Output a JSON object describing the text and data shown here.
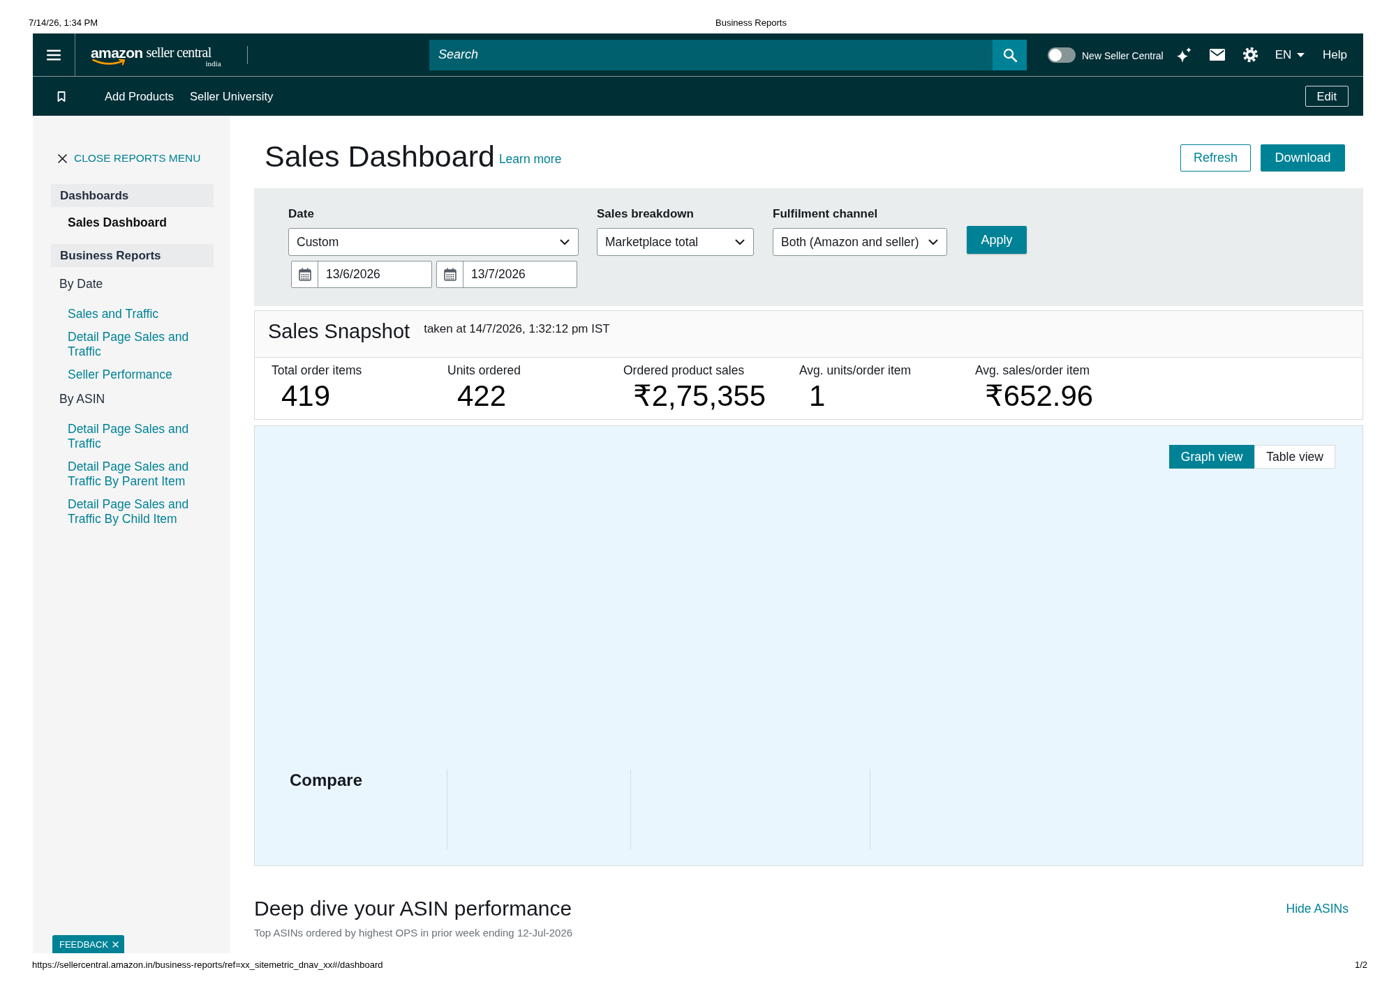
{
  "print_header": {
    "date_time": "7/14/26, 1:34 PM",
    "title": "Business Reports"
  },
  "top_nav": {
    "logo": {
      "wordmark": "amazon",
      "product": "seller central",
      "region": "india"
    },
    "search": {
      "placeholder": "Search"
    },
    "new_seller_toggle": {
      "label": "New Seller Central",
      "on": false
    },
    "language": "EN",
    "help": "Help"
  },
  "sub_nav": {
    "links": [
      "Add Products",
      "Seller University"
    ],
    "edit_button": "Edit"
  },
  "sidebar": {
    "close_link": "CLOSE REPORTS MENU",
    "sections": [
      {
        "title": "Dashboards",
        "items": [
          {
            "label": "Sales Dashboard",
            "selected": true
          }
        ]
      },
      {
        "title": "Business Reports",
        "items": [
          {
            "label": "By Date",
            "children": [
              {
                "label": "Sales and Traffic",
                "selected": false
              },
              {
                "label": "Detail Page Sales and Traffic",
                "selected": false
              },
              {
                "label": "Seller Performance",
                "selected": false
              }
            ]
          },
          {
            "label": "By ASIN",
            "children": [
              {
                "label": "Detail Page Sales and Traffic",
                "selected": false
              },
              {
                "label": "Detail Page Sales and Traffic By Parent Item",
                "selected": false
              },
              {
                "label": "Detail Page Sales and Traffic By Child Item",
                "selected": false
              }
            ]
          }
        ]
      }
    ],
    "feedback_tab": "FEEDBACK"
  },
  "page_header": {
    "title": "Sales Dashboard",
    "learn_more": "Learn more",
    "buttons": [
      {
        "label": "Refresh",
        "kind": "secondary"
      },
      {
        "label": "Download",
        "kind": "primary"
      }
    ]
  },
  "filters": {
    "date": {
      "label": "Date",
      "value": "Custom",
      "from": "13/6/2026",
      "to": "13/7/2026"
    },
    "selects": [
      {
        "label": "Sales breakdown",
        "value": "Marketplace total"
      },
      {
        "label": "Fulfilment channel",
        "value": "Both (Amazon and seller)"
      }
    ],
    "apply_button": "Apply"
  },
  "sales_snapshot": {
    "title": "Sales Snapshot",
    "taken_at": "taken at 14/7/2026, 1:32:12 pm IST",
    "metrics": [
      {
        "label": "Total order items",
        "value": "419"
      },
      {
        "label": "Units ordered",
        "value": "422"
      },
      {
        "label": "Ordered product sales",
        "value": "₹2,75,355"
      },
      {
        "label": "Avg. units/order item",
        "value": "1"
      },
      {
        "label": "Avg. sales/order item",
        "value": "₹652.96"
      }
    ]
  },
  "graph_panel": {
    "view_toggle": [
      {
        "label": "Graph view",
        "selected": true
      },
      {
        "label": "Table view",
        "selected": false
      }
    ],
    "compare_label": "Compare"
  },
  "asin_section": {
    "title": "Deep dive your ASIN performance",
    "subtitle": "Top ASINs ordered by highest OPS in prior week ending 12-Jul-2026",
    "hide_link": "Hide ASINs"
  },
  "print_footer": {
    "url": "https://sellercentral.amazon.in/business-reports/ref=xx_sitemetric_dnav_xx#/dashboard",
    "page": "1/2"
  }
}
